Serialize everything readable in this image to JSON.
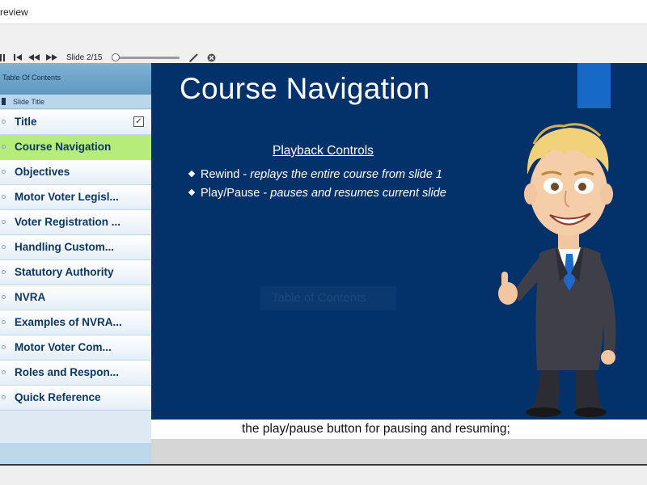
{
  "window": {
    "title": "review"
  },
  "toolbar": {
    "icons": [
      "pause-icon",
      "skip-to-start-icon",
      "rewind-icon",
      "fast-forward-icon",
      "pen-icon",
      "close-icon"
    ],
    "slide_counter": "Slide 2/15",
    "progress_fraction": 0.02
  },
  "sidebar": {
    "header": "Table Of Contents",
    "column_header": "Slide Title",
    "items": [
      {
        "label": "Title",
        "checked": true
      },
      {
        "label": "Course Navigation",
        "active": true
      },
      {
        "label": "Objectives"
      },
      {
        "label": "Motor Voter Legisl..."
      },
      {
        "label": "Voter Registration ..."
      },
      {
        "label": "Handling Custom..."
      },
      {
        "label": "Statutory Authority"
      },
      {
        "label": "NVRA"
      },
      {
        "label": "Examples of NVRA..."
      },
      {
        "label": "Motor Voter Com..."
      },
      {
        "label": "Roles and Respon..."
      },
      {
        "label": "Quick Reference"
      }
    ]
  },
  "slide": {
    "title": "Course Navigation",
    "subheading": "Playback Controls",
    "bullets": [
      {
        "term": "Rewind",
        "separator": " - ",
        "desc": "replays the entire course from slide 1"
      },
      {
        "term": "Play/Pause",
        "separator": " - ",
        "desc": "pauses and resumes current slide"
      }
    ],
    "ghost_text": "Table of Contents",
    "colors": {
      "background": "#03326a",
      "accent": "#1769c8"
    }
  },
  "caption": {
    "text": "the play/pause button for pausing and resuming;"
  }
}
